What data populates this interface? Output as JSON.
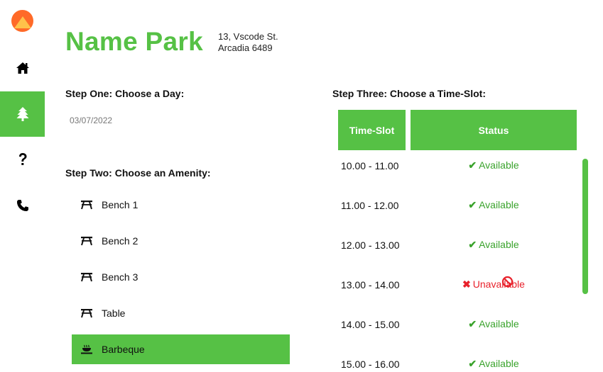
{
  "brand": {
    "logo_icon": "sunrise-logo-icon",
    "colors": {
      "accent": "#56c145",
      "logo": "#ff6a28",
      "logo_inner": "#ffc24a"
    }
  },
  "sidebar": {
    "items": [
      {
        "icon": "home-icon",
        "active": false
      },
      {
        "icon": "tree-icon",
        "active": true
      },
      {
        "icon": "question-icon",
        "active": false
      },
      {
        "icon": "phone-icon",
        "active": false
      }
    ]
  },
  "park": {
    "name": "Name Park",
    "address_line1": "13, Vscode St.",
    "address_line2": "Arcadia 6489"
  },
  "step_one": {
    "label": "Step One: Choose a Day:",
    "date": "03/07/2022"
  },
  "step_two": {
    "label": "Step Two: Choose an Amenity:",
    "amenities": [
      {
        "label": "Bench 1",
        "icon": "picnic-table-icon",
        "selected": false
      },
      {
        "label": "Bench 2",
        "icon": "picnic-table-icon",
        "selected": false
      },
      {
        "label": "Bench 3",
        "icon": "picnic-table-icon",
        "selected": false
      },
      {
        "label": "Table",
        "icon": "picnic-table-icon",
        "selected": false
      },
      {
        "label": "Barbeque",
        "icon": "barbeque-icon",
        "selected": true
      }
    ]
  },
  "step_three": {
    "label": "Step Three: Choose a Time-Slot:",
    "columns": [
      "Time-Slot",
      "Status"
    ],
    "slots": [
      {
        "time": "10.00 - 11.00",
        "status": "Available",
        "available": true
      },
      {
        "time": "11.00 - 12.00",
        "status": "Available",
        "available": true
      },
      {
        "time": "12.00 - 13.00",
        "status": "Available",
        "available": true
      },
      {
        "time": "13.00 - 14.00",
        "status": "Unavailable",
        "available": false
      },
      {
        "time": "14.00 - 15.00",
        "status": "Available",
        "available": true
      },
      {
        "time": "15.00 - 16.00",
        "status": "Available",
        "available": true
      }
    ]
  },
  "glyphs": {
    "check": "✔",
    "cross": "✖"
  }
}
